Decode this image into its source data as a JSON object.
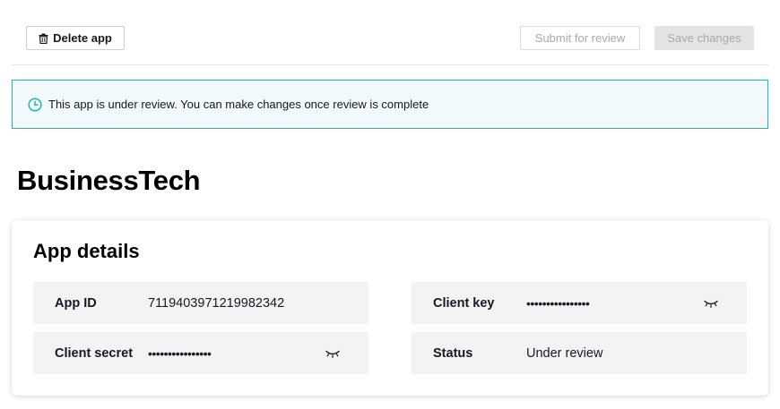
{
  "toolbar": {
    "delete_label": "Delete app",
    "submit_label": "Submit for review",
    "save_label": "Save changes"
  },
  "banner": {
    "icon": "clock-icon",
    "text": "This app is under review. You can make changes once review is complete",
    "accent_color": "#25b4b8"
  },
  "app": {
    "name": "BusinessTech"
  },
  "details": {
    "title": "App details",
    "fields": {
      "app_id": {
        "label": "App ID",
        "value": "7119403971219982342"
      },
      "client_secret": {
        "label": "Client secret",
        "value": "••••••••••••••••"
      },
      "client_key": {
        "label": "Client key",
        "value": "••••••••••••••••"
      },
      "status": {
        "label": "Status",
        "value": "Under review"
      }
    }
  }
}
